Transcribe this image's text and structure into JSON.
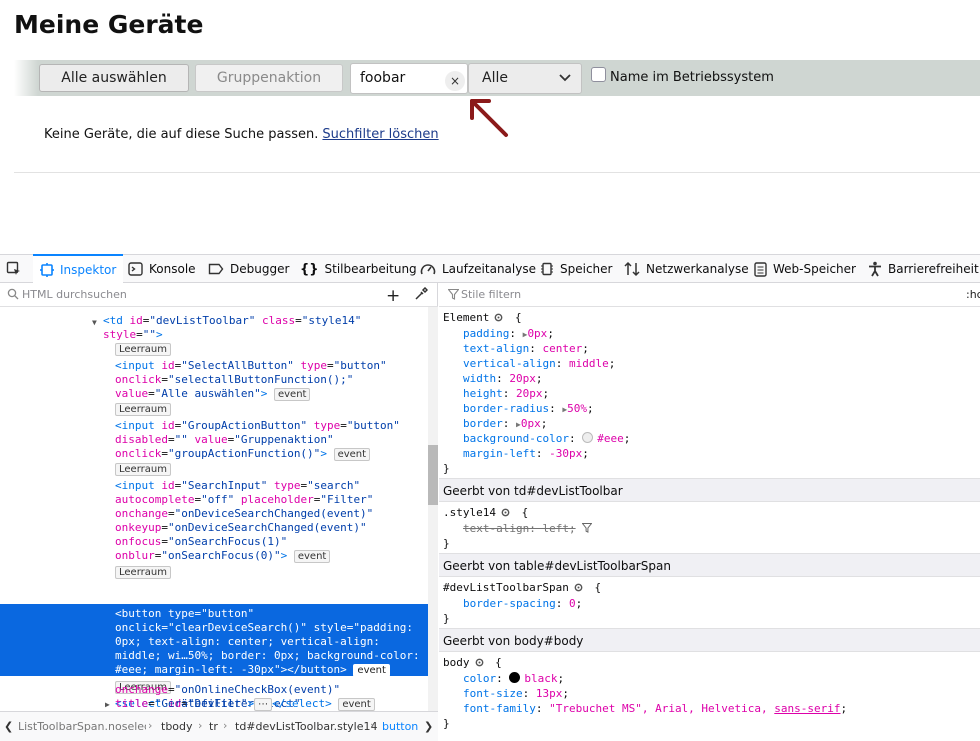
{
  "page": {
    "title": "Meine Geräte",
    "select_all": "Alle auswählen",
    "group_action": "Gruppenaktion",
    "search_value": "foobar",
    "clear_glyph": "×",
    "filter_select": "Alle",
    "os_checkbox_label": "Name im Betriebssystem",
    "empty_message": "Keine Geräte, die auf diese Suche passen.",
    "clear_filter_link": "Suchfilter löschen"
  },
  "devtools": {
    "tabs": [
      "Inspektor",
      "Konsole",
      "Debugger",
      "Stilbearbeitung",
      "Laufzeitanalyse",
      "Speicher",
      "Netzwerkanalyse",
      "Web-Speicher",
      "Barrierefreiheit"
    ],
    "html_search_placeholder": "HTML durchsuchen",
    "styles_filter_placeholder": "Stile filtern",
    "hov_label": ":hc",
    "whitespace_label": "Leerraum",
    "event_label": "event",
    "ellipsis_label": "⋯",
    "markup": {
      "l0": "<td id=\"devListToolbar\" class=\"style14\"",
      "l0_tag": "<td",
      "l0_a1": "id",
      "l0_v1": "\"devListToolbar\"",
      "l0_a2": "class",
      "l0_v2": "\"style14\"",
      "l1_a": "style",
      "l1_v": "\"\"",
      "i1_tag": "<input",
      "i1_a1": "id",
      "i1_v1": "\"SelectAllButton\"",
      "i1_a2": "type",
      "i1_v2": "\"button\"",
      "i1_a3": "onclick",
      "i1_v3": "\"selectallButtonFunction();\"",
      "i1_a4": "value",
      "i1_v4": "\"Alle auswählen\"",
      "i2_tag": "<input",
      "i2_a1": "id",
      "i2_v1": "\"GroupActionButton\"",
      "i2_a2": "type",
      "i2_v2": "\"button\"",
      "i2_a3": "disabled",
      "i2_v3": "\"\"",
      "i2_a4": "value",
      "i2_v4": "\"Gruppenaktion\"",
      "i2_a5": "onclick",
      "i2_v5": "\"groupActionFunction()\"",
      "i3_tag": "<input",
      "i3_a1": "id",
      "i3_v1": "\"SearchInput\"",
      "i3_a2": "type",
      "i3_v2": "\"search\"",
      "i3_a3": "autocomplete",
      "i3_v3": "\"off\"",
      "i3_a4": "placeholder",
      "i3_v4": "\"Filter\"",
      "i3_a5": "onchange",
      "i3_v5": "\"onDeviceSearchChanged(event)\"",
      "i3_a6": "onkeyup",
      "i3_v6": "\"onDeviceSearchChanged(event)\"",
      "i3_a7": "onfocus",
      "i3_v7": "\"onSearchFocus(1)\"",
      "i3_a8": "onblur",
      "i3_v8": "\"onSearchFocus(0)\"",
      "b_line1": "<button type=\"button\"",
      "b_line2": "onclick=\"clearDeviceSearch()\" style=\"padding:",
      "b_line3": "0px; text-align: center; vertical-align:",
      "b_line4": "middle; wi…50%; border: 0px; background-color:",
      "b_line5": "#eee; margin-left: -30px\"></button>",
      "s_tag": "<select",
      "s_a1": "id",
      "s_v1": "\"DevFilterSelect\"",
      "s_a2": "onchange",
      "s_v2": "\"onOnlineCheckBox(event)\"",
      "s_a3": "title",
      "s_v3": "\"Gerätefilter\"",
      "s_close": "</select>"
    },
    "breadcrumbs": [
      "ListToolbarSpan.noselect",
      "tbody",
      "tr",
      "td#devListToolbar.style14",
      "button"
    ],
    "rules": {
      "element_selector": "Element",
      "element_props": [
        {
          "name": "padding",
          "value": "0px",
          "arrow": true
        },
        {
          "name": "text-align",
          "value": "center"
        },
        {
          "name": "vertical-align",
          "value": "middle"
        },
        {
          "name": "width",
          "value": "20px"
        },
        {
          "name": "height",
          "value": "20px"
        },
        {
          "name": "border-radius",
          "value": "50%",
          "arrow": true
        },
        {
          "name": "border",
          "value": "0px",
          "arrow": true
        },
        {
          "name": "background-color",
          "value": "#eee",
          "swatch": "#eeeeee"
        },
        {
          "name": "margin-left",
          "value": "-30px"
        }
      ],
      "inherited_td": "Geerbt von td#devListToolbar",
      "style14_selector": ".style14",
      "style14_prop": "text-align: left;",
      "inherited_table": "Geerbt von table#devListToolbarSpan",
      "span_selector": "#devListToolbarSpan",
      "span_prop_name": "border-spacing",
      "span_prop_value": "0",
      "inherited_body": "Geerbt von body#body",
      "body_selector": "body",
      "body_props": [
        {
          "name": "color",
          "value": "black",
          "swatch": "#000000"
        },
        {
          "name": "font-size",
          "value": "13px"
        },
        {
          "name": "font-family",
          "value": "\"Trebuchet MS\", Arial, Helvetica,",
          "tail": "sans-serif"
        }
      ]
    }
  },
  "colors": {
    "accent": "#0a84ff",
    "selection": "#0a68e0",
    "arrow": "#8b1a1a",
    "toolbar_band": "#cfd6d2"
  }
}
